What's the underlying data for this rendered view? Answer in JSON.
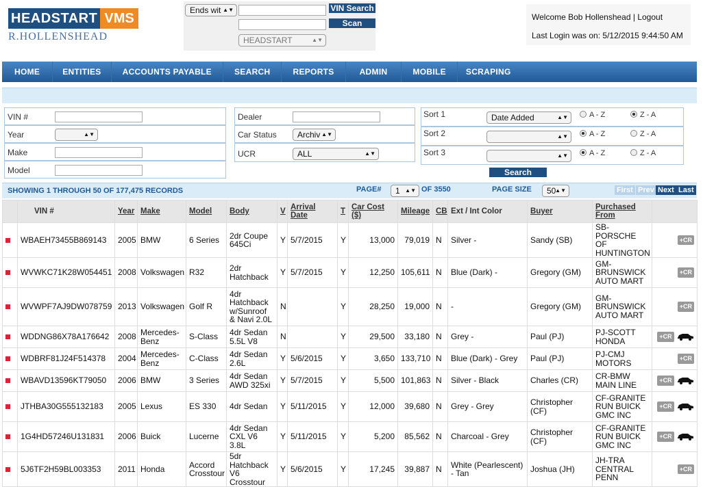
{
  "header": {
    "logo_part1": "HEADSTART",
    "logo_part2": "VMS",
    "subtitle": "R.HOLLENSHEAD",
    "search_mode": "Ends wit",
    "vin_search_label": "VIN Search",
    "scan_label": "Scan",
    "dealer_select": "HEADSTART",
    "welcome": "Welcome Bob Hollenshead",
    "logout": "Logout",
    "last_login": "Last Login was on: 5/12/2015 9:44:50 AM"
  },
  "nav": [
    "HOME",
    "ENTITIES",
    "ACCOUNTS PAYABLE",
    "SEARCH",
    "REPORTS",
    "ADMIN",
    "MOBILE",
    "SCRAPING"
  ],
  "filters": {
    "vin_label": "VIN #",
    "year_label": "Year",
    "make_label": "Make",
    "model_label": "Model",
    "dealer_label": "Dealer",
    "car_status_label": "Car Status",
    "car_status_value": "Archiv",
    "ucr_label": "UCR",
    "ucr_value": "ALL",
    "sort1_label": "Sort 1",
    "sort1_value": "Date Added",
    "sort2_label": "Sort 2",
    "sort3_label": "Sort 3",
    "asc": "A - Z",
    "desc": "Z - A",
    "search_button": "Search"
  },
  "results": {
    "showing": "SHOWING 1 THROUGH 50 OF 177,475 RECORDS",
    "page_label": "PAGE#",
    "page_value": "1",
    "page_of": "OF 3550",
    "page_size_label": "PAGE SIZE",
    "page_size_value": "50",
    "first": "First",
    "prev": "Prev",
    "next": "Next",
    "last": "Last"
  },
  "table": {
    "columns": [
      "VIN #",
      "Year",
      "Make",
      "Model",
      "Body",
      "V",
      "Arrival Date",
      "T",
      "Car Cost ($)",
      "Mileage",
      "CB",
      "Ext / Int Color",
      "Buyer",
      "Purchased From"
    ],
    "cr_label": "+CR",
    "rows": [
      {
        "vin": "WBAEH73455B869143",
        "year": "2005",
        "make": "BMW",
        "model": "6 Series",
        "body": "2dr Coupe 645Ci",
        "v": "Y",
        "arrival": "5/7/2015",
        "t": "Y",
        "cost": "13,000",
        "mileage": "79,019",
        "cb": "N",
        "color": "Silver -",
        "buyer": "Sandy (SB)",
        "from": "SB-PORSCHE OF HUNTINGTON",
        "car": false
      },
      {
        "vin": "WVWKC71K28W054451",
        "year": "2008",
        "make": "Volkswagen",
        "model": "R32",
        "body": "2dr Hatchback",
        "v": "Y",
        "arrival": "5/7/2015",
        "t": "Y",
        "cost": "12,250",
        "mileage": "105,611",
        "cb": "N",
        "color": "Blue (Dark) -",
        "buyer": "Gregory (GM)",
        "from": "GM-BRUNSWICK AUTO MART",
        "car": false
      },
      {
        "vin": "WVWPF7AJ9DW078759",
        "year": "2013",
        "make": "Volkswagen",
        "model": "Golf R",
        "body": "4dr Hatchback w/Sunroof & Navi 2.0L",
        "v": "N",
        "arrival": "",
        "t": "Y",
        "cost": "28,250",
        "mileage": "19,000",
        "cb": "N",
        "color": "-",
        "buyer": "Gregory (GM)",
        "from": "GM-BRUNSWICK AUTO MART",
        "car": false
      },
      {
        "vin": "WDDNG86X78A176642",
        "year": "2008",
        "make": "Mercedes-Benz",
        "model": "S-Class",
        "body": "4dr Sedan 5.5L V8",
        "v": "N",
        "arrival": "",
        "t": "Y",
        "cost": "29,500",
        "mileage": "33,180",
        "cb": "N",
        "color": "Grey -",
        "buyer": "Paul (PJ)",
        "from": "PJ-SCOTT HONDA",
        "car": true
      },
      {
        "vin": "WDBRF81J24F514378",
        "year": "2004",
        "make": "Mercedes-Benz",
        "model": "C-Class",
        "body": "4dr Sedan 2.6L",
        "v": "Y",
        "arrival": "5/6/2015",
        "t": "Y",
        "cost": "3,650",
        "mileage": "133,710",
        "cb": "N",
        "color": "Blue (Dark) - Grey",
        "buyer": "Paul (PJ)",
        "from": "PJ-CMJ MOTORS",
        "car": false
      },
      {
        "vin": "WBAVD13596KT79050",
        "year": "2006",
        "make": "BMW",
        "model": "3 Series",
        "body": "4dr Sedan AWD 325xi",
        "v": "Y",
        "arrival": "5/7/2015",
        "t": "Y",
        "cost": "5,500",
        "mileage": "101,863",
        "cb": "N",
        "color": "Silver - Black",
        "buyer": "Charles (CR)",
        "from": "CR-BMW MAIN LINE",
        "car": true
      },
      {
        "vin": "JTHBA30G555132183",
        "year": "2005",
        "make": "Lexus",
        "model": "ES 330",
        "body": "4dr Sedan",
        "v": "Y",
        "arrival": "5/11/2015",
        "t": "Y",
        "cost": "12,000",
        "mileage": "39,680",
        "cb": "N",
        "color": "Grey - Grey",
        "buyer": "Christopher (CF)",
        "from": "CF-GRANITE RUN BUICK GMC INC",
        "car": true
      },
      {
        "vin": "1G4HD57246U131831",
        "year": "2006",
        "make": "Buick",
        "model": "Lucerne",
        "body": "4dr Sedan CXL V6 3.8L",
        "v": "Y",
        "arrival": "5/11/2015",
        "t": "Y",
        "cost": "5,200",
        "mileage": "85,562",
        "cb": "N",
        "color": "Charcoal - Grey",
        "buyer": "Christopher (CF)",
        "from": "CF-GRANITE RUN BUICK GMC INC",
        "car": true
      },
      {
        "vin": "5J6TF2H59BL003353",
        "year": "2011",
        "make": "Honda",
        "model": "Accord Crosstour",
        "body": "5dr Hatchback V6 Crosstour",
        "v": "Y",
        "arrival": "5/6/2015",
        "t": "Y",
        "cost": "17,245",
        "mileage": "39,887",
        "cb": "N",
        "color": "White (Pearlescent) - Tan",
        "buyer": "Joshua (JH)",
        "from": "JH-TRA CENTRAL PENN",
        "car": false
      }
    ]
  }
}
